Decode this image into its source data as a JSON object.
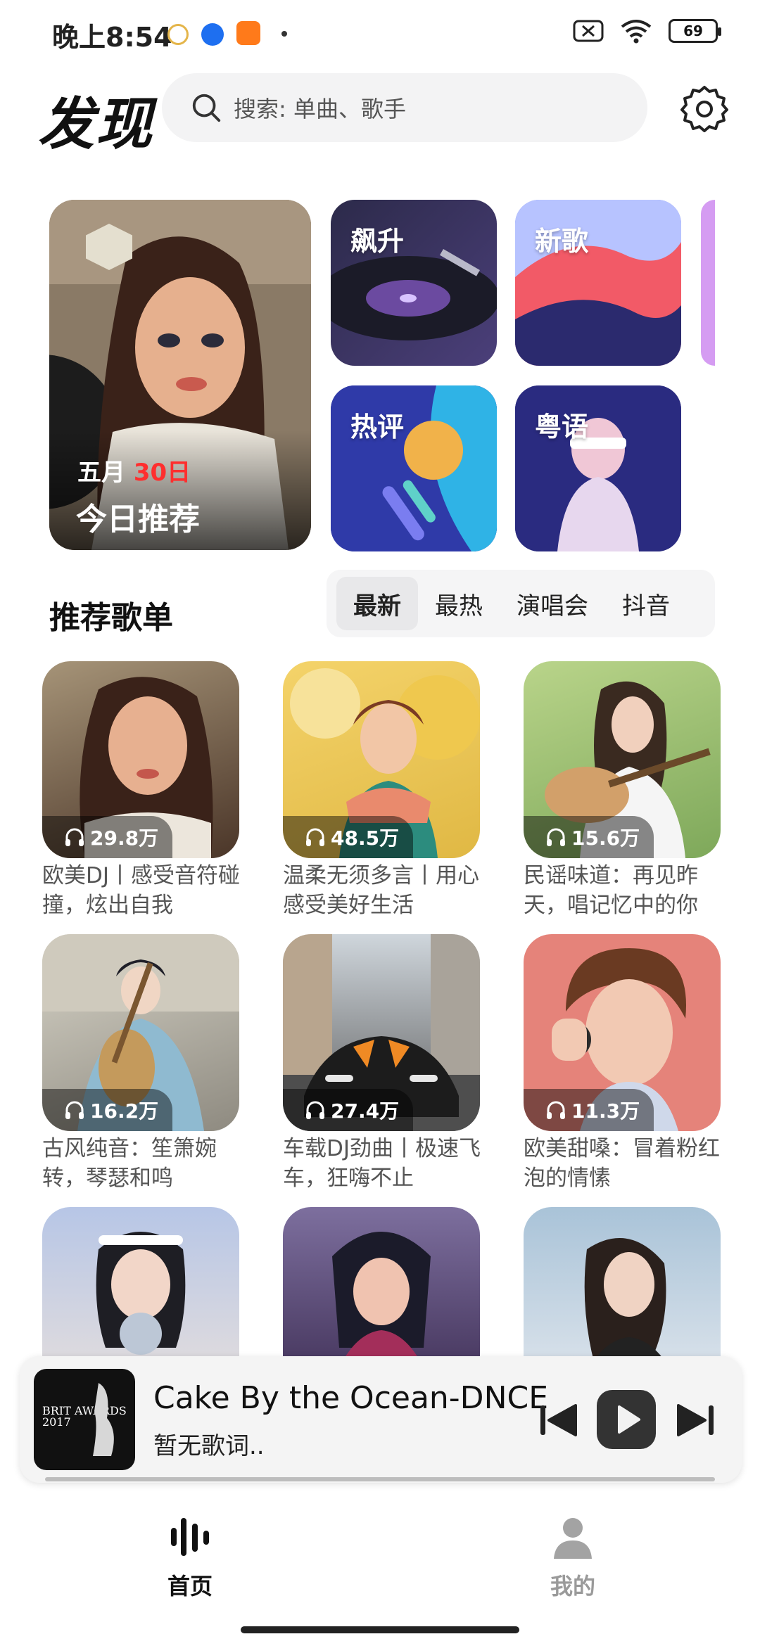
{
  "status_bar": {
    "time": "晚上8:54",
    "battery": "69",
    "icons": [
      "alarm-icon",
      "browser-icon",
      "shop-app-icon",
      "dot-icon",
      "sim-icon",
      "wifi-icon",
      "battery-icon"
    ]
  },
  "header": {
    "title": "发现",
    "search_placeholder": "搜索: 单曲、歌手",
    "settings_icon": "gear-icon"
  },
  "featured": {
    "daily": {
      "month": "五月",
      "day": "30日",
      "title": "今日推荐"
    },
    "tiles": [
      {
        "label": "飙升"
      },
      {
        "label": "新歌"
      },
      {
        "label": "热评"
      },
      {
        "label": "粤语"
      }
    ]
  },
  "playlists": {
    "title": "推荐歌单",
    "tabs": [
      {
        "label": "最新",
        "active": true
      },
      {
        "label": "最热",
        "active": false
      },
      {
        "label": "演唱会",
        "active": false
      },
      {
        "label": "抖音",
        "active": false
      }
    ],
    "items": [
      {
        "plays": "29.8万",
        "title": "欧美DJ丨感受音符碰撞，炫出自我"
      },
      {
        "plays": "48.5万",
        "title": "温柔无须多言丨用心感受美好生活"
      },
      {
        "plays": "15.6万",
        "title": "民谣味道：再见昨天，唱记忆中的你"
      },
      {
        "plays": "16.2万",
        "title": "古风纯音：笙箫婉转，琴瑟和鸣"
      },
      {
        "plays": "27.4万",
        "title": "车载DJ劲曲丨极速飞车，狂嗨不止"
      },
      {
        "plays": "11.3万",
        "title": "欧美甜嗓：冒着粉红泡的情愫"
      }
    ]
  },
  "player": {
    "title": "Cake By the Ocean-DNCE",
    "lyric": "暂无歌词..",
    "cover_text": "BRIT AWARDS 2017"
  },
  "bottom_nav": {
    "items": [
      {
        "label": "首页",
        "active": true
      },
      {
        "label": "我的",
        "active": false
      }
    ]
  },
  "colors": {
    "accent_red": "#ff2e2e",
    "search_bg": "#f3f3f4",
    "nav_inactive": "#9a9a9a"
  }
}
